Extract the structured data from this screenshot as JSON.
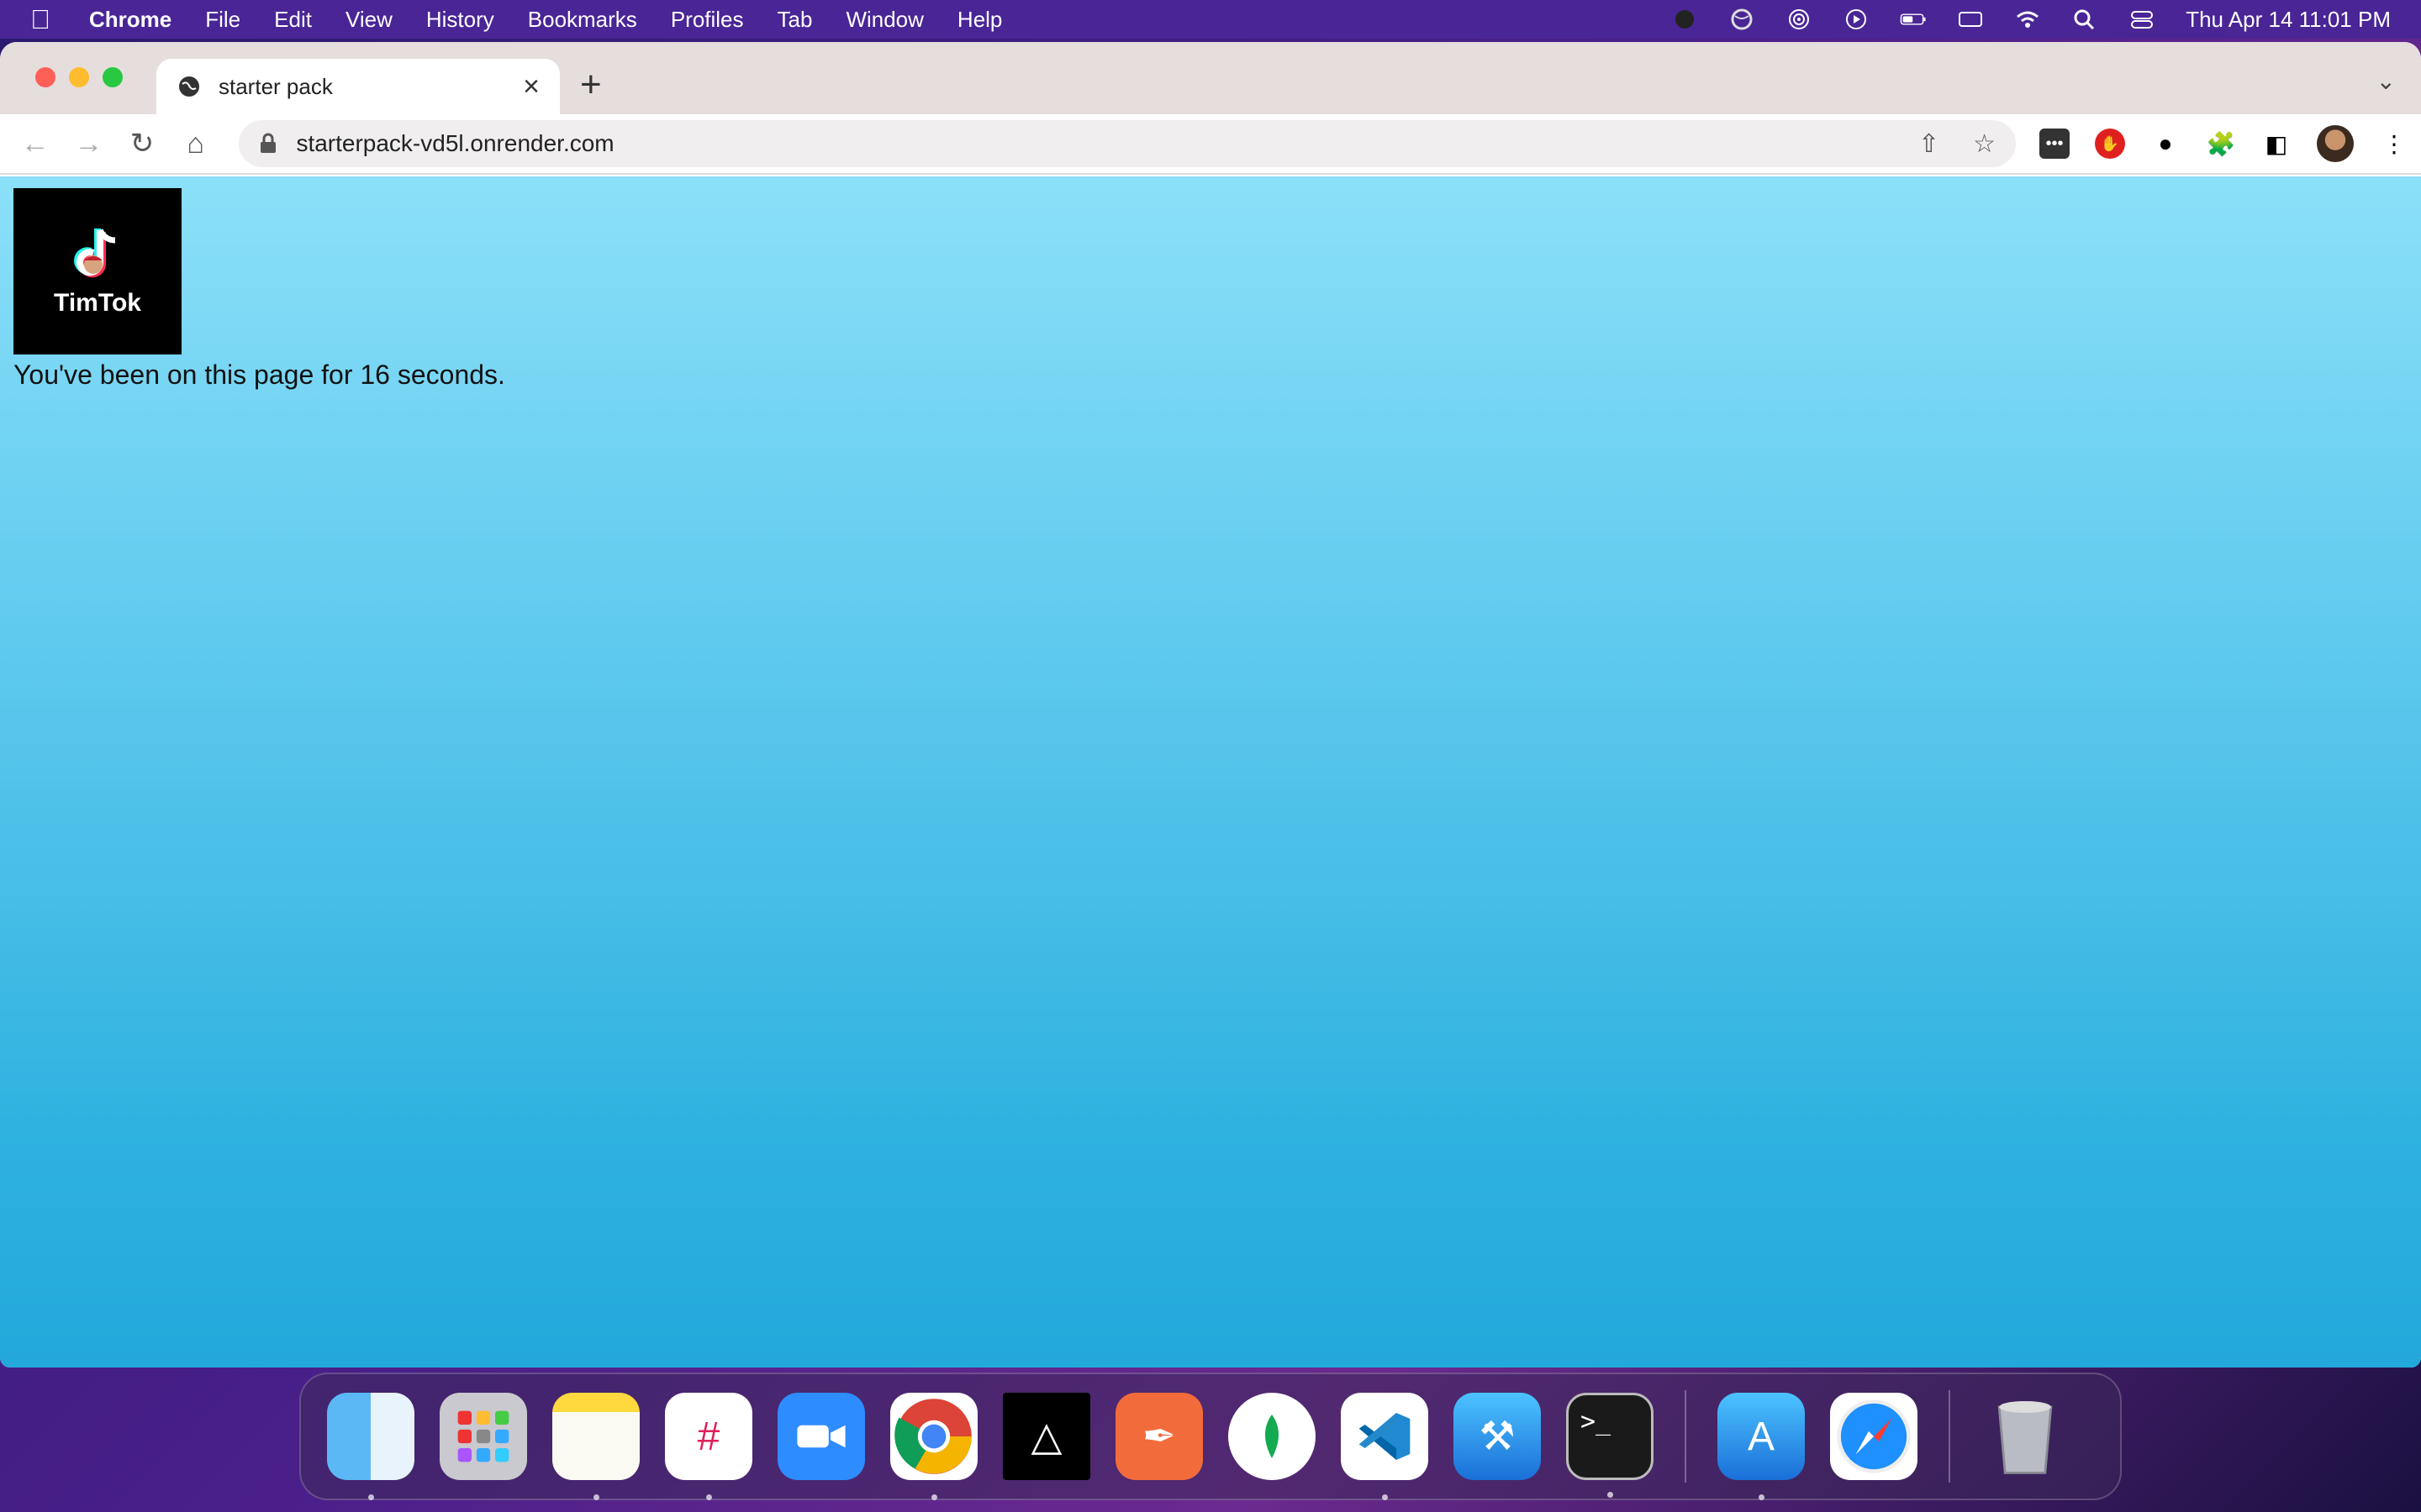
{
  "menubar": {
    "app_name": "Chrome",
    "items": [
      "File",
      "Edit",
      "View",
      "History",
      "Bookmarks",
      "Profiles",
      "Tab",
      "Window",
      "Help"
    ],
    "clock": "Thu Apr 14  11:01 PM"
  },
  "browser": {
    "tab_title": "starter pack",
    "url": "starterpack-vd5l.onrender.com"
  },
  "page": {
    "logo_text": "TimTok",
    "timer_text": "You've been on this page for 16 seconds."
  },
  "dock": {
    "apps": [
      "finder",
      "launchpad",
      "notes",
      "slack",
      "zoom",
      "chrome",
      "unity",
      "postman",
      "mongodb-compass",
      "vscode",
      "xcode",
      "terminal",
      "app-store-connect",
      "safari",
      "trash"
    ]
  },
  "colors": {
    "menubar_bg": "#4a2596",
    "page_gradient_top": "#8be0f9",
    "page_gradient_bottom": "#23a8dc"
  }
}
